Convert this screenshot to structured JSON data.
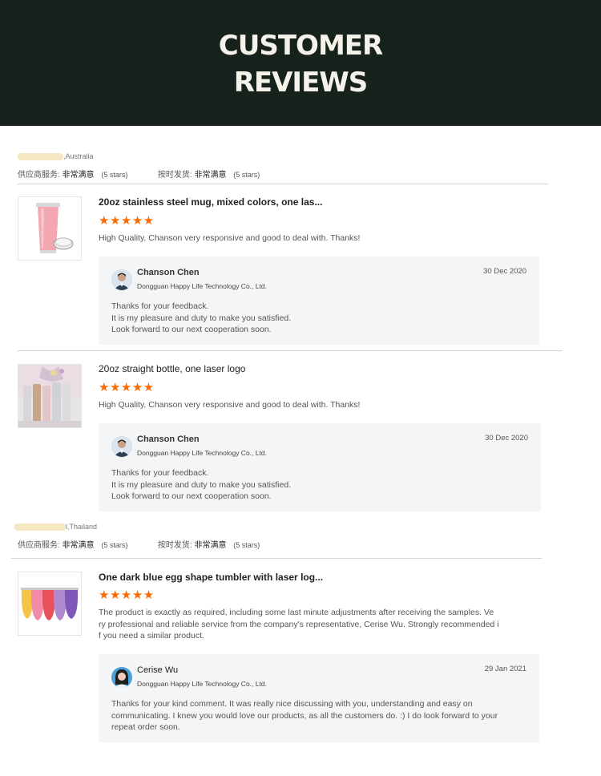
{
  "banner": {
    "line1": "CUSTOMER",
    "line2": "REVIEWS"
  },
  "groups": [
    {
      "location": ",Australia",
      "supplier_service_label": "供应商服务:",
      "supplier_service_value": "非常满意",
      "supplier_service_stars": "(5 stars)",
      "ontime_label": "按时发货:",
      "ontime_value": "非常满意",
      "ontime_stars": "(5 stars)"
    },
    {
      "location": "l,Thailand",
      "supplier_service_label": "供应商服务:",
      "supplier_service_value": "非常满意",
      "supplier_service_stars": "(5 stars)",
      "ontime_label": "按时发货:",
      "ontime_value": "非常满意",
      "ontime_stars": "(5 stars)"
    }
  ],
  "reviews": [
    {
      "title": "20oz stainless steel mug, mixed colors, one las...",
      "stars": "★★★★★",
      "rating": 5,
      "text": "High Quality, Chanson very responsive and good to deal with. Thanks!",
      "reply": {
        "name": "Chanson Chen",
        "company": "Dongguan Happy Life Technology Co., Ltd.",
        "date": "30 Dec 2020",
        "lines": [
          "Thanks for your feedback.",
          "It is my pleasure and duty to make you satisfied.",
          "Look forward to our next cooperation soon."
        ]
      }
    },
    {
      "title": "20oz straight bottle, one laser logo",
      "stars": "★★★★★",
      "rating": 5,
      "text": "High Quality, Chanson very responsive and good to deal with. Thanks!",
      "reply": {
        "name": "Chanson Chen",
        "company": "Dongguan Happy Life Technology Co., Ltd.",
        "date": "30 Dec 2020",
        "lines": [
          "Thanks for your feedback.",
          "It is my pleasure and duty to make you satisfied.",
          "Look forward to our next cooperation soon."
        ]
      }
    },
    {
      "title": "One dark blue egg shape tumbler with laser log...",
      "stars": "★★★★★",
      "rating": 5,
      "text_lines": [
        "The product is exactly as required, including some last minute adjustments after receiving the samples. Ve",
        "ry professional and reliable service from the company's representative, Cerise Wu. Strongly recommended i",
        "f you need a similar product."
      ],
      "reply": {
        "name": "Cerise Wu",
        "company": "Dongguan Happy Life Technology Co., Ltd.",
        "date": "29 Jan 2021",
        "lines": [
          "Thanks for your kind comment. It was really nice discussing with you, understanding and easy on",
          "communicating. I knew you would love our products, as all the customers do. :)  I do look forward to your",
          "repeat order soon."
        ]
      }
    }
  ]
}
